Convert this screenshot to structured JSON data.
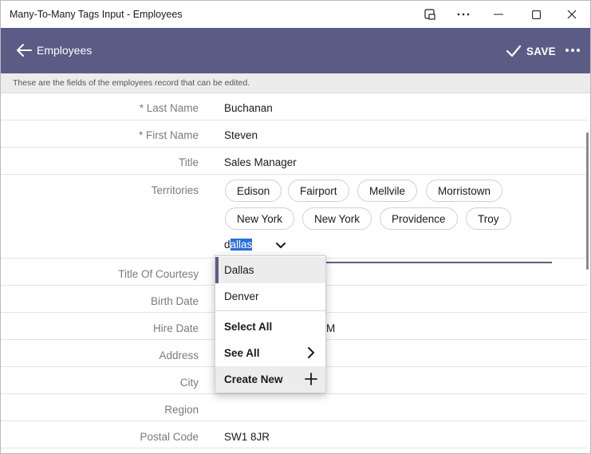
{
  "window": {
    "title": "Many-To-Many Tags Input - Employees"
  },
  "appbar": {
    "title": "Employees",
    "save_label": "SAVE"
  },
  "info": "These are the fields of the employees record that can be edited.",
  "fields": {
    "last_name": {
      "label": "* Last Name",
      "value": "Buchanan"
    },
    "first_name": {
      "label": "* First Name",
      "value": "Steven"
    },
    "title": {
      "label": "Title",
      "value": "Sales Manager"
    },
    "territories": {
      "label": "Territories"
    },
    "title_of_courtesy": {
      "label": "Title Of Courtesy"
    },
    "birth_date": {
      "label": "Birth Date"
    },
    "hire_date": {
      "label": "Hire Date",
      "value_partial": "M"
    },
    "address": {
      "label": "Address"
    },
    "city": {
      "label": "City"
    },
    "region": {
      "label": "Region"
    },
    "postal_code": {
      "label": "Postal Code",
      "value": "SW1 8JR"
    }
  },
  "tags": [
    "Edison",
    "Fairport",
    "Mellvile",
    "Morristown",
    "New York",
    "New York",
    "Providence",
    "Troy"
  ],
  "tag_input": {
    "typed_prefix": "d",
    "typed_selected": "allas"
  },
  "dropdown": {
    "suggestions": [
      "Dallas",
      "Denver"
    ],
    "select_all": "Select All",
    "see_all": "See All",
    "create_new": "Create New"
  },
  "icons": {
    "back": "arrow-left-icon",
    "save": "check-icon",
    "more": "more-horizontal-icon",
    "chevron": "chevron-down-icon",
    "see_all": "chevron-right-icon",
    "create_new": "plus-icon"
  },
  "colors": {
    "accent": "#5b5c85",
    "selection": "#2a6de0"
  }
}
